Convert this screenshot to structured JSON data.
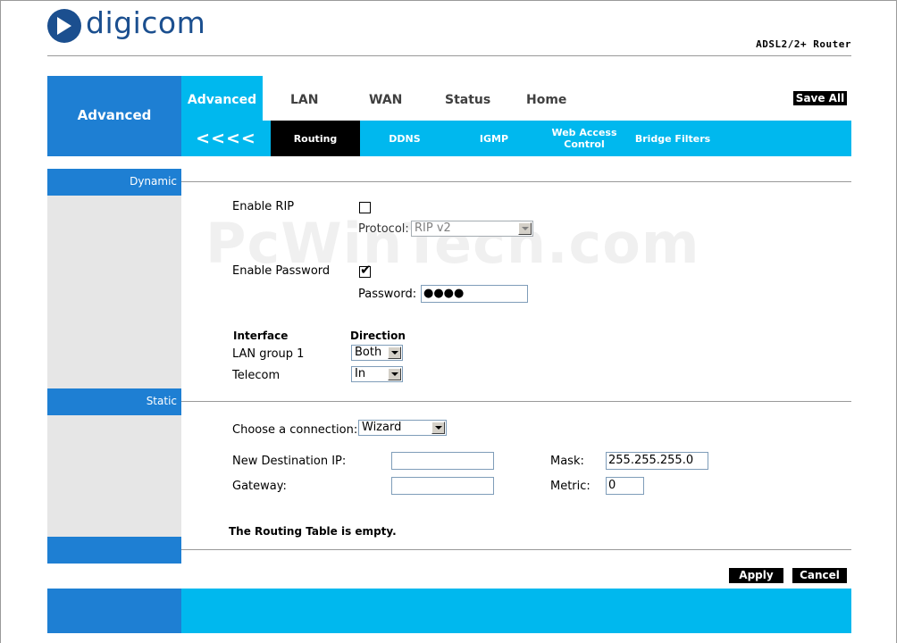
{
  "brand": {
    "logo_text": "digicom",
    "subtitle": "ADSL2/2+ Router"
  },
  "watermark": "PcWinTech.com",
  "nav": {
    "section_label": "Advanced",
    "tabs": [
      "Advanced",
      "LAN",
      "WAN",
      "Status",
      "Home"
    ],
    "active_tab": "Advanced",
    "save_all": "Save All",
    "back": "<<<<",
    "subtabs": [
      "Routing",
      "DDNS",
      "IGMP",
      "Web Access Control",
      "Bridge Filters"
    ],
    "active_subtab": "Routing"
  },
  "sidebar": {
    "dynamic": "Dynamic",
    "static": "Static"
  },
  "dynamic": {
    "enable_rip_label": "Enable RIP",
    "enable_rip_checked": false,
    "protocol_label": "Protocol:",
    "protocol_value": "RIP v2",
    "enable_password_label": "Enable Password",
    "enable_password_checked": true,
    "password_label": "Password:",
    "password_value": "●●●●",
    "interface_header": "Interface",
    "direction_header": "Direction",
    "rows": [
      {
        "interface": "LAN group 1",
        "direction": "Both"
      },
      {
        "interface": "Telecom",
        "direction": "In"
      }
    ]
  },
  "static": {
    "choose_connection_label": "Choose a connection:",
    "connection_value": "Wizard",
    "dest_ip_label": "New Destination IP:",
    "dest_ip_value": "",
    "mask_label": "Mask:",
    "mask_value": "255.255.255.0",
    "gateway_label": "Gateway:",
    "gateway_value": "",
    "metric_label": "Metric:",
    "metric_value": "0",
    "routing_table_message": "The Routing Table is empty."
  },
  "buttons": {
    "apply": "Apply",
    "cancel": "Cancel"
  },
  "colors": {
    "nav_blue": "#1e7fd3",
    "nav_cyan": "#00b8ee",
    "logo_blue": "#1b4f8f"
  }
}
